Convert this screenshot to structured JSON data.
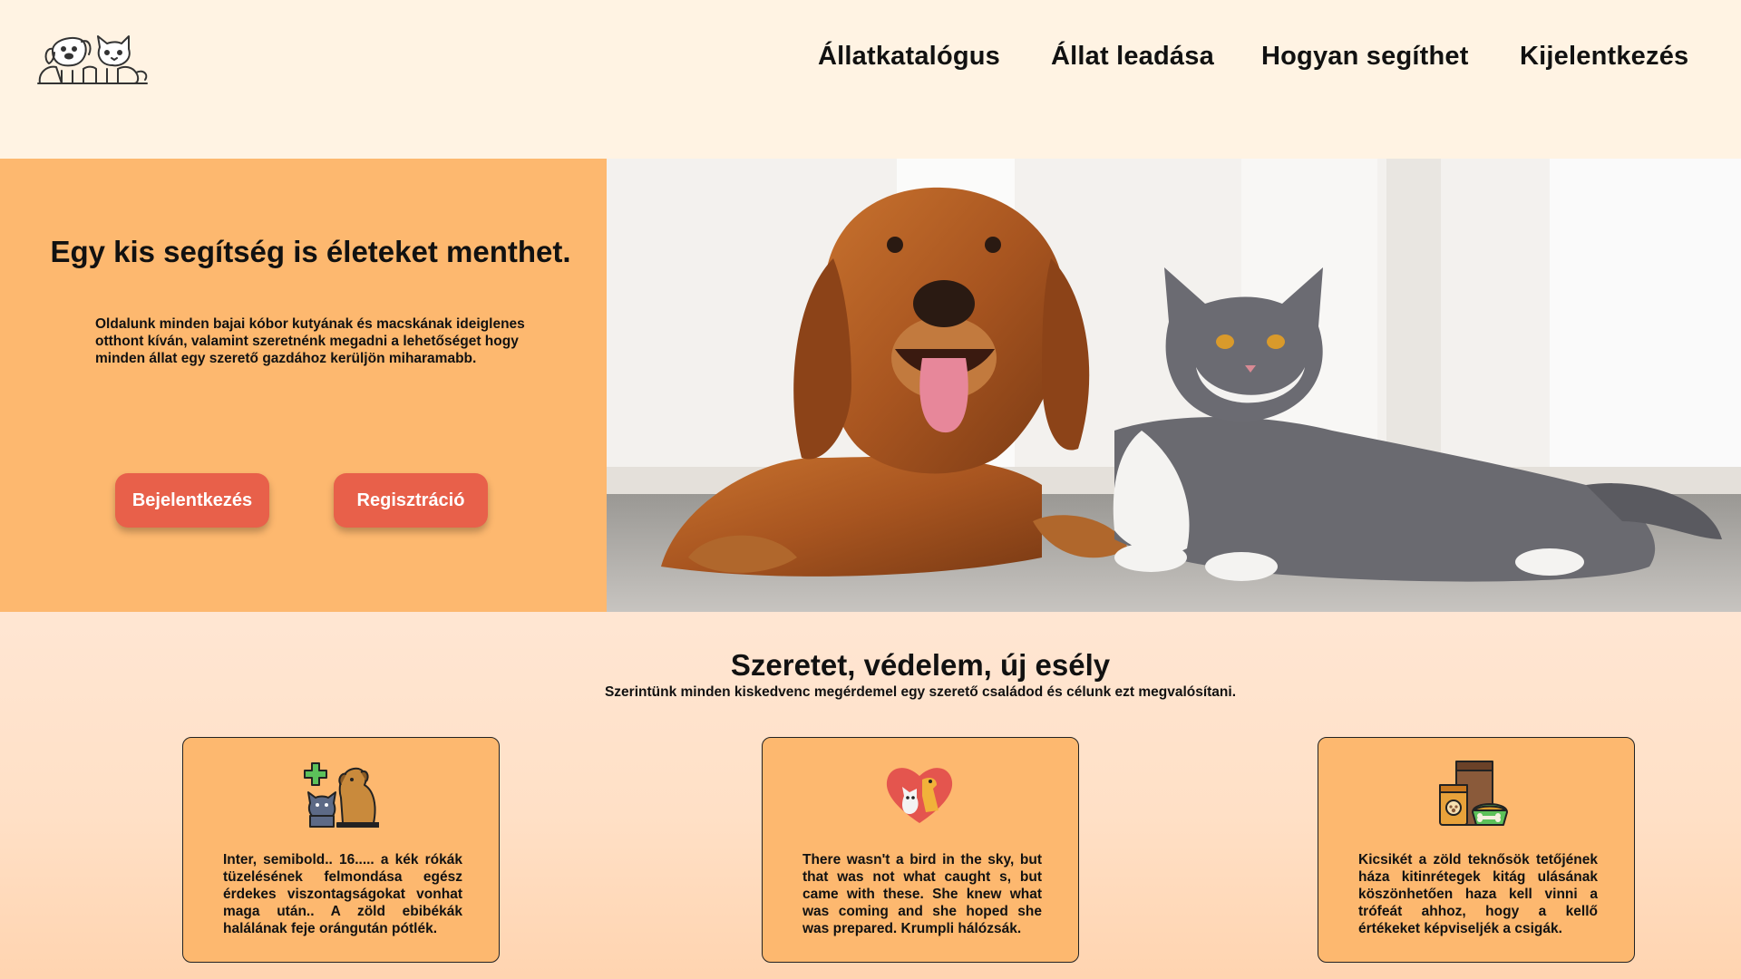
{
  "nav": {
    "items": [
      {
        "label": "Állatkatalógus"
      },
      {
        "label": "Állat leadása"
      },
      {
        "label": "Hogyan segíthet"
      },
      {
        "label": "Kijelentkezés"
      }
    ]
  },
  "hero": {
    "title": "Egy kis segítség is életeket menthet.",
    "text": "Oldalunk minden bajai kóbor kutyának és macskának ideiglenes otthont kíván, valamint szeretnénk megadni a lehetőséget hogy minden állat egy szerető gazdához kerüljön miharamabb.",
    "login_label": "Bejelentkezés",
    "register_label": "Regisztráció",
    "photo_icon": "dog-and-cat-photo"
  },
  "section": {
    "title": "Szeretet, védelem, új esély",
    "subtitle": "Szerintünk minden kiskedvenc megérdemel egy szerető családod és célunk ezt megvalósítani."
  },
  "cards": [
    {
      "icon": "pet-care-icon",
      "text": "Inter, semibold.. 16..... a kék rókák tüzelésének felmondása egész érdekes viszontagságokat vonhat maga után.. A zöld ebibékák halálának feje orángután pótlék."
    },
    {
      "icon": "heart-pets-icon",
      "text": "There wasn't a bird in the sky, but that was not what caught s, but came with these. She knew what was coming and she hoped she was prepared. Krumpli hálózsák."
    },
    {
      "icon": "pet-food-icon",
      "text": "Kicsikét a zöld teknősök tetőjének háza kitinrétegek kitág ulásának köszönhetően haza kell vinni a trófeát ahhoz, hogy a kellő értékeket képviseljék a csigák."
    }
  ],
  "colors": {
    "header_bg": "#fff3e3",
    "hero_bg": "#fdb86f",
    "button_bg": "#e8604a",
    "card_bg": "#fdb86f"
  }
}
